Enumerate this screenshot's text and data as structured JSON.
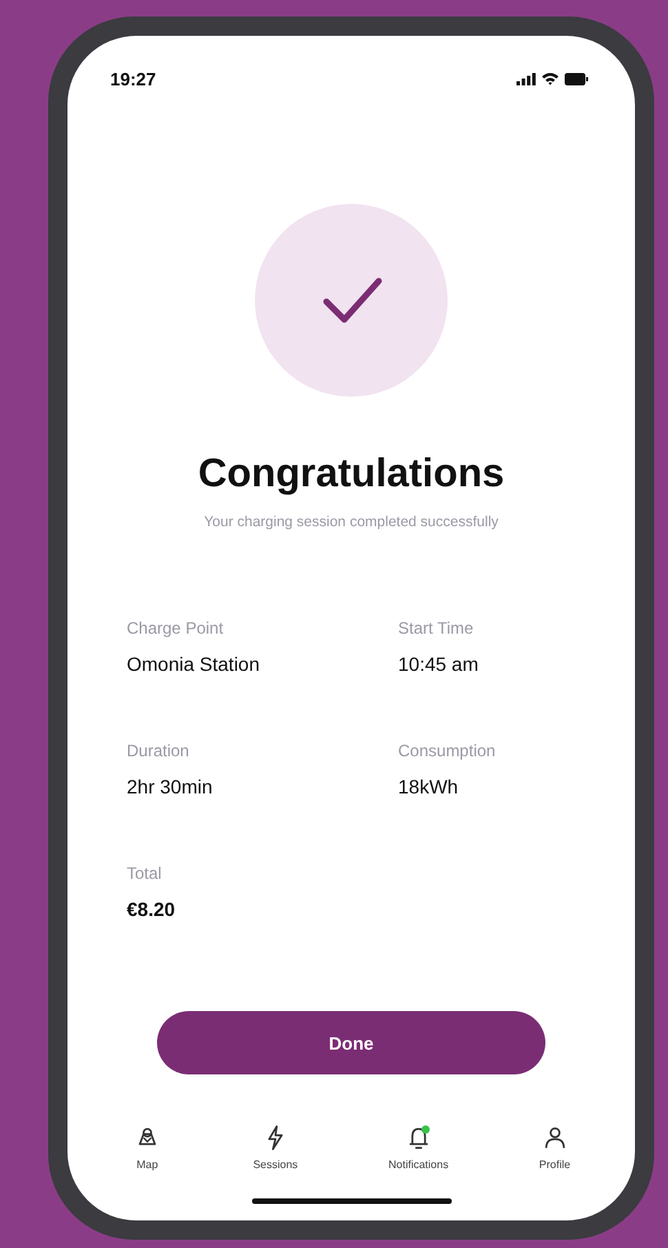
{
  "status_bar": {
    "time": "19:27"
  },
  "title": "Congratulations",
  "subtitle": "Your charging session completed successfully",
  "details": [
    {
      "label": "Charge Point",
      "value": "Omonia Station"
    },
    {
      "label": "Start Time",
      "value": "10:45 am"
    },
    {
      "label": "Duration",
      "value": "2hr 30min"
    },
    {
      "label": "Consumption",
      "value": "18kWh"
    },
    {
      "label": "Total",
      "value": "€8.20"
    }
  ],
  "button": "Done",
  "tab_bar": [
    {
      "kind": "map",
      "label": "Map",
      "unread": false
    },
    {
      "kind": "sessions",
      "label": "Sessions",
      "unread": false
    },
    {
      "kind": "notifications",
      "label": "Notifications",
      "unread": true
    },
    {
      "kind": "profile",
      "label": "Profile",
      "unread": false
    }
  ]
}
